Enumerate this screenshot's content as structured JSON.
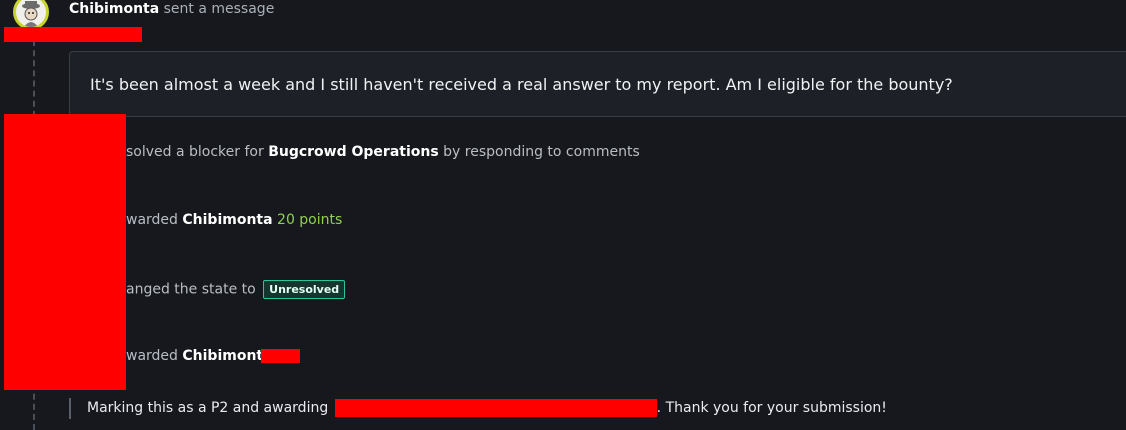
{
  "header": {
    "username": "Chibimonta",
    "action": "sent a message"
  },
  "message": {
    "text": "It's been almost a week and I still haven't received a real answer to my report. Am I eligible for the bounty?"
  },
  "events": [
    {
      "prefix": "solved a blocker for",
      "target": "Bugcrowd Operations",
      "suffix": "by responding to comments"
    },
    {
      "prefix": "warded",
      "target": "Chibimonta",
      "value": "20 points"
    },
    {
      "prefix": "anged the state to",
      "badge": "Unresolved"
    },
    {
      "prefix": "warded",
      "target": "Chibimonta",
      "value": "$"
    }
  ],
  "comment": {
    "before": "Marking this as a P2 and awarding",
    "after": ". Thank you for your submission!"
  },
  "colors": {
    "background": "#16181d",
    "card": "#1d2026",
    "accent_green": "#8fd14f",
    "badge_border": "#2ec4a0",
    "redaction": "#ff0000"
  }
}
